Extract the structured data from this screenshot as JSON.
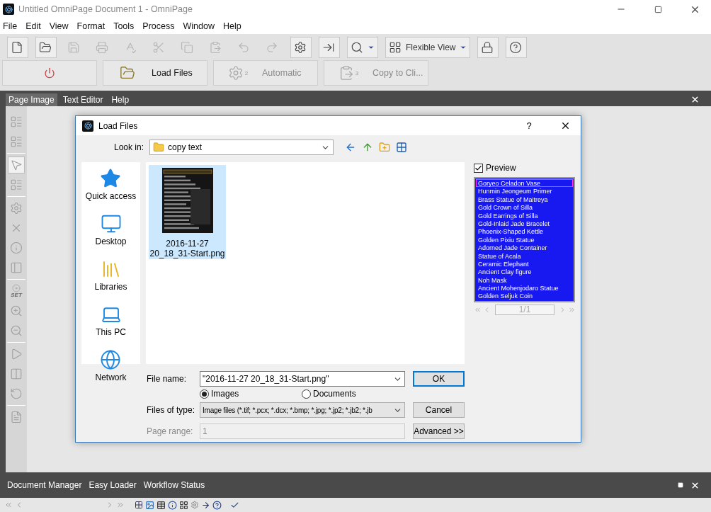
{
  "window": {
    "title": "Untitled OmniPage Document 1 - OmniPage"
  },
  "menu": [
    "File",
    "Edit",
    "View",
    "Format",
    "Tools",
    "Process",
    "Window",
    "Help"
  ],
  "toolbar": [
    {
      "kind": "new",
      "disabled": false
    },
    {
      "kind": "open",
      "disabled": false
    },
    {
      "kind": "save",
      "disabled": true
    },
    {
      "kind": "print",
      "disabled": true
    },
    {
      "kind": "spell",
      "disabled": true
    },
    {
      "kind": "cut",
      "disabled": true
    },
    {
      "kind": "copy",
      "disabled": true
    },
    {
      "kind": "paste",
      "disabled": true
    },
    {
      "kind": "undo",
      "disabled": true
    },
    {
      "kind": "redo",
      "disabled": true
    },
    {
      "kind": "settings",
      "disabled": false
    },
    {
      "kind": "export",
      "disabled": false
    },
    {
      "kind": "zoom",
      "disabled": false
    },
    {
      "kind": "view",
      "disabled": false,
      "label": "Flexible View"
    },
    {
      "kind": "lock",
      "disabled": false
    },
    {
      "kind": "help",
      "disabled": false
    }
  ],
  "workflow": [
    {
      "kind": "power"
    },
    {
      "kind": "load",
      "label": "Load Files",
      "disabled": false
    },
    {
      "kind": "auto",
      "label": "Automatic",
      "step": "2",
      "disabled": true
    },
    {
      "kind": "copy",
      "label": "Copy to Cli...",
      "step": "3",
      "disabled": true
    }
  ],
  "tabs": [
    {
      "label": "Page Image",
      "selected": true
    },
    {
      "label": "Text Editor",
      "selected": false
    },
    {
      "label": "Help",
      "selected": false
    }
  ],
  "left_tools": [
    {
      "kind": "layout",
      "selected": false
    },
    {
      "kind": "layout2",
      "selected": false
    },
    {
      "kind": "separator"
    },
    {
      "kind": "pointer",
      "selected": true
    },
    {
      "kind": "zones",
      "selected": false
    },
    {
      "kind": "separator"
    },
    {
      "kind": "gear",
      "selected": false
    },
    {
      "kind": "delete",
      "selected": false
    },
    {
      "kind": "info",
      "selected": false
    },
    {
      "kind": "panel",
      "selected": false
    },
    {
      "kind": "separator"
    },
    {
      "kind": "set",
      "label": "SET",
      "selected": false
    },
    {
      "kind": "zoom-in",
      "selected": false
    },
    {
      "kind": "zoom-out",
      "selected": false
    },
    {
      "kind": "separator"
    },
    {
      "kind": "play",
      "selected": false
    },
    {
      "kind": "columns",
      "selected": false
    },
    {
      "kind": "rotate",
      "selected": false
    },
    {
      "kind": "separator"
    },
    {
      "kind": "document",
      "selected": false
    }
  ],
  "dialog": {
    "title": "Load Files",
    "help": "?",
    "look_in": {
      "label": "Look in:",
      "value": "copy text"
    },
    "places": [
      {
        "kind": "star",
        "label": "Quick access"
      },
      {
        "kind": "desktop",
        "label": "Desktop"
      },
      {
        "kind": "libraries",
        "label": "Libraries"
      },
      {
        "kind": "pc",
        "label": "This PC"
      },
      {
        "kind": "network",
        "label": "Network"
      }
    ],
    "files": [
      {
        "name": "2016-11-27 20_18_31-Start.png",
        "selected": true,
        "kind": "picture"
      }
    ],
    "preview": {
      "label": "Preview",
      "checked": true,
      "page": "1/1",
      "items": [
        {
          "label": "Goryeo Celadon Vase",
          "selected": true
        },
        {
          "label": "Hunmin Jeongeum Primer",
          "selected": false
        },
        {
          "label": "Brass Statue of Maitreya",
          "selected": false
        },
        {
          "label": "Gold Crown of Silla",
          "selected": false
        },
        {
          "label": "Gold Earrings of Silla",
          "selected": false
        },
        {
          "label": "Gold-Inlaid Jade Bracelet",
          "selected": false
        },
        {
          "label": "Phoenix-Shaped Kettle",
          "selected": false
        },
        {
          "label": "Golden Pixiu Statue",
          "selected": false
        },
        {
          "label": "Adorned Jade Container",
          "selected": false
        },
        {
          "label": "Statue of Acala",
          "selected": false
        },
        {
          "label": "Ceramic Elephant",
          "selected": false
        },
        {
          "label": "Ancient Clay figure",
          "selected": false
        },
        {
          "label": "Noh Mask",
          "selected": false
        },
        {
          "label": "Ancient Mohenjodaro Statue",
          "selected": false
        },
        {
          "label": "Golden Seljuk Coin",
          "selected": false
        }
      ]
    },
    "file_name": {
      "label": "File name:",
      "value": "\"2016-11-27 20_18_31-Start.png\""
    },
    "radios": [
      {
        "label": "Images",
        "selected": true
      },
      {
        "label": "Documents",
        "selected": false
      }
    ],
    "files_of_type": {
      "label": "Files of type:",
      "value": "Image files (*.tif; *.pcx; *.dcx; *.bmp; *.jpg; *.jp2; *.jb2; *.jb"
    },
    "page_range": {
      "label": "Page range:",
      "value": "1",
      "disabled": true
    },
    "buttons": [
      "OK",
      "Cancel",
      "Advanced >>"
    ]
  },
  "bottom_tabs": [
    "Document Manager",
    "Easy Loader",
    "Workflow Status"
  ]
}
